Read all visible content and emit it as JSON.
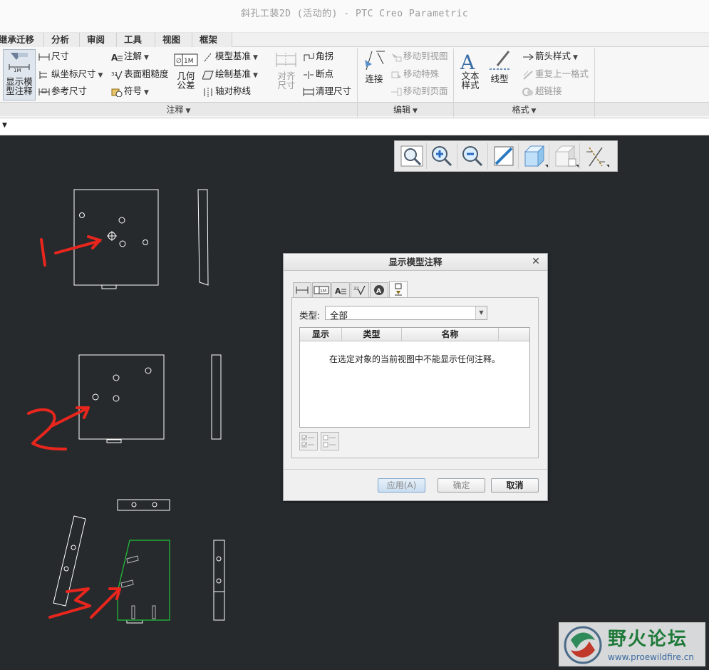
{
  "window": {
    "title": "斜孔工装2D (活动的) - PTC Creo Parametric"
  },
  "tabs": [
    "继承迁移",
    "分析",
    "审阅",
    "工具",
    "视图",
    "框架"
  ],
  "ribbon": {
    "annotate_group": {
      "label": "注释",
      "show_model_annotations": "显示模\n型注释",
      "dimension": "尺寸",
      "ordinate_dimension": "纵坐标尺寸",
      "reference_dimension": "参考尺寸",
      "note": "注解",
      "surface_finish": "表面粗糙度",
      "symbol": "符号",
      "geometric_tolerance": "几何\n公差",
      "model_datum": "模型基准",
      "sketched_datum": "绘制基准",
      "axis_symmetry": "轴对称线",
      "align_dimension": "对齐\n尺寸",
      "jog": "角拐",
      "breakpoint": "断点",
      "cleanup_dimension": "清理尺寸"
    },
    "edit_group": {
      "label": "编辑",
      "connect": "连接",
      "move_to_view": "移动到视图",
      "move_special": "移动特殊",
      "move_to_page": "移动到页面"
    },
    "format_group": {
      "label": "格式",
      "text_style": "文本\n样式",
      "line_style": "线型",
      "arrow_style": "箭头样式",
      "repeat_last_format": "重复上一格式",
      "hyperlink": "超链接"
    }
  },
  "dialog": {
    "title": "显示模型注释",
    "type_label": "类型",
    "type_value": "全部",
    "columns": [
      "显示",
      "类型",
      "名称"
    ],
    "empty_message": "在选定对象的当前视图中不能显示任何注释。",
    "apply": "应用(A)",
    "ok": "确定",
    "cancel": "取消"
  },
  "annotations": {
    "label1": "1",
    "label2": "2",
    "label3": "3"
  },
  "watermark": {
    "text": "野火论坛",
    "url": "www.proewildfire.cn"
  },
  "colors": {
    "canvas": "#262a2c",
    "drawing": "#ffffff",
    "highlight": "#22c43a",
    "markup": "#e8261e"
  }
}
